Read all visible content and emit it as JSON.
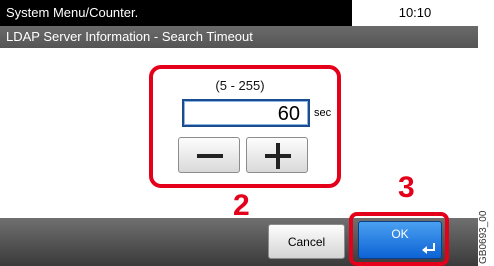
{
  "header": {
    "title": "System Menu/Counter.",
    "time": "10:10"
  },
  "subheader": {
    "title": "LDAP Server Information - Search Timeout"
  },
  "timeout_input": {
    "range_label": "(5 - 255)",
    "value": "60",
    "unit": "sec"
  },
  "stepper": {
    "decrement_icon": "minus-icon",
    "increment_icon": "plus-icon"
  },
  "footer": {
    "cancel_label": "Cancel",
    "ok_label": "OK",
    "ok_icon": "enter-icon"
  },
  "callouts": {
    "step_a": "2",
    "step_b": "3",
    "color": "#e4001b"
  },
  "figure_code": "GB0693_00",
  "colors": {
    "title_bar": "#000000",
    "sub_bar": "#5f5f5f",
    "ok_button": "#1d74e0",
    "field_border": "#1a4d8f"
  }
}
